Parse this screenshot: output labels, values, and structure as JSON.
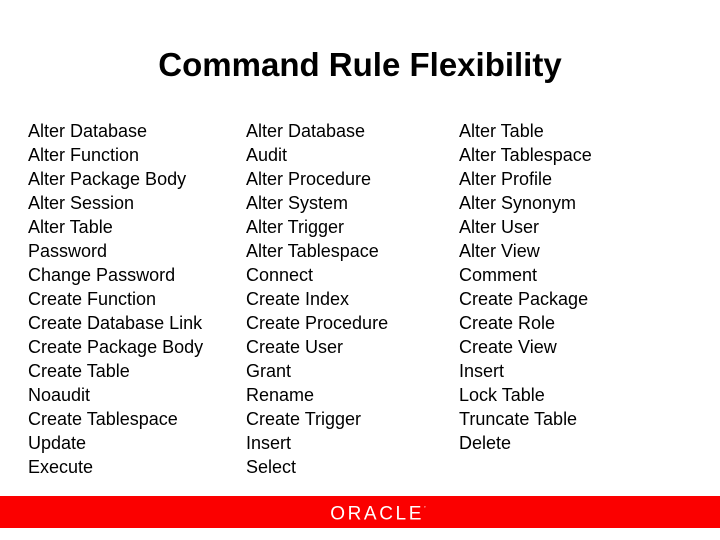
{
  "slide": {
    "title": "Command Rule Flexibility",
    "background_color": "#ffffff",
    "text_color": "#000000"
  },
  "columns": [
    {
      "name": "column-1",
      "items": [
        "Alter Database",
        "Alter Function",
        "Alter Package Body",
        "Alter Session",
        "Alter Table",
        "Password",
        "Change Password",
        "Create Function",
        "Create Database Link",
        "Create Package Body",
        "Create Table",
        "Noaudit",
        "Create Tablespace",
        "Update",
        "Execute"
      ]
    },
    {
      "name": "column-2",
      "items": [
        "Alter Database",
        "Audit",
        "Alter Procedure",
        "Alter System",
        "Alter Trigger",
        "Alter Tablespace",
        "Connect",
        "Create Index",
        "Create Procedure",
        "Create User",
        "Grant",
        "Rename",
        "Create Trigger",
        "Insert",
        "Select"
      ]
    },
    {
      "name": "column-3",
      "items": [
        "Alter Table",
        "Alter Tablespace",
        "Alter Profile",
        "Alter Synonym",
        "Alter User",
        "Alter View",
        "Comment",
        "Create Package",
        "Create Role",
        "Create View",
        "Insert",
        "Lock Table",
        "Truncate Table",
        "Delete"
      ]
    }
  ],
  "footer": {
    "brand": "ORACLE",
    "trademark": "’",
    "bar_color": "#fb0000",
    "brand_color": "#ffffff"
  }
}
